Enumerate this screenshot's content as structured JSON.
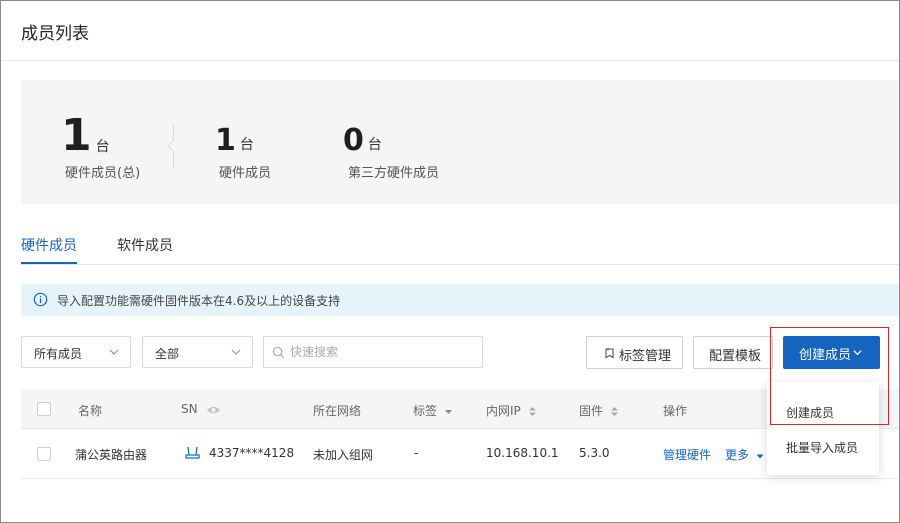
{
  "header": {
    "title": "成员列表"
  },
  "stats": [
    {
      "num": "1",
      "unit": "台",
      "label": "硬件成员(总)"
    },
    {
      "num": "1",
      "unit": "台",
      "label": "硬件成员"
    },
    {
      "num": "0",
      "unit": "台",
      "label": "第三方硬件成员"
    }
  ],
  "tabs": [
    {
      "label": "硬件成员",
      "active": true
    },
    {
      "label": "软件成员",
      "active": false
    }
  ],
  "notice": {
    "text": "导入配置功能需硬件固件版本在4.6及以上的设备支持"
  },
  "filters": {
    "member_select": "所有成员",
    "scope_select": "全部",
    "search_placeholder": "快速搜索"
  },
  "toolbar": {
    "tag_manage": "标签管理",
    "config_template": "配置模板",
    "create_member": "创建成员"
  },
  "dropdown": {
    "items": [
      "创建成员",
      "批量导入成员"
    ]
  },
  "table": {
    "headers": {
      "name": "名称",
      "sn": "SN",
      "network": "所在网络",
      "tag": "标签",
      "ip": "内网IP",
      "firmware": "固件",
      "action": "操作"
    },
    "rows": [
      {
        "name": "蒲公英路由器",
        "sn": "4337****4128",
        "network": "未加入组网",
        "tag": "-",
        "ip": "10.168.10.1",
        "firmware": "5.3.0",
        "manage": "管理硬件",
        "more": "更多"
      }
    ]
  },
  "colors": {
    "primary": "#1565c0",
    "highlight": "#d9262c",
    "notice_bg": "#e7f3fb",
    "panel_bg": "#f4f5f7"
  }
}
